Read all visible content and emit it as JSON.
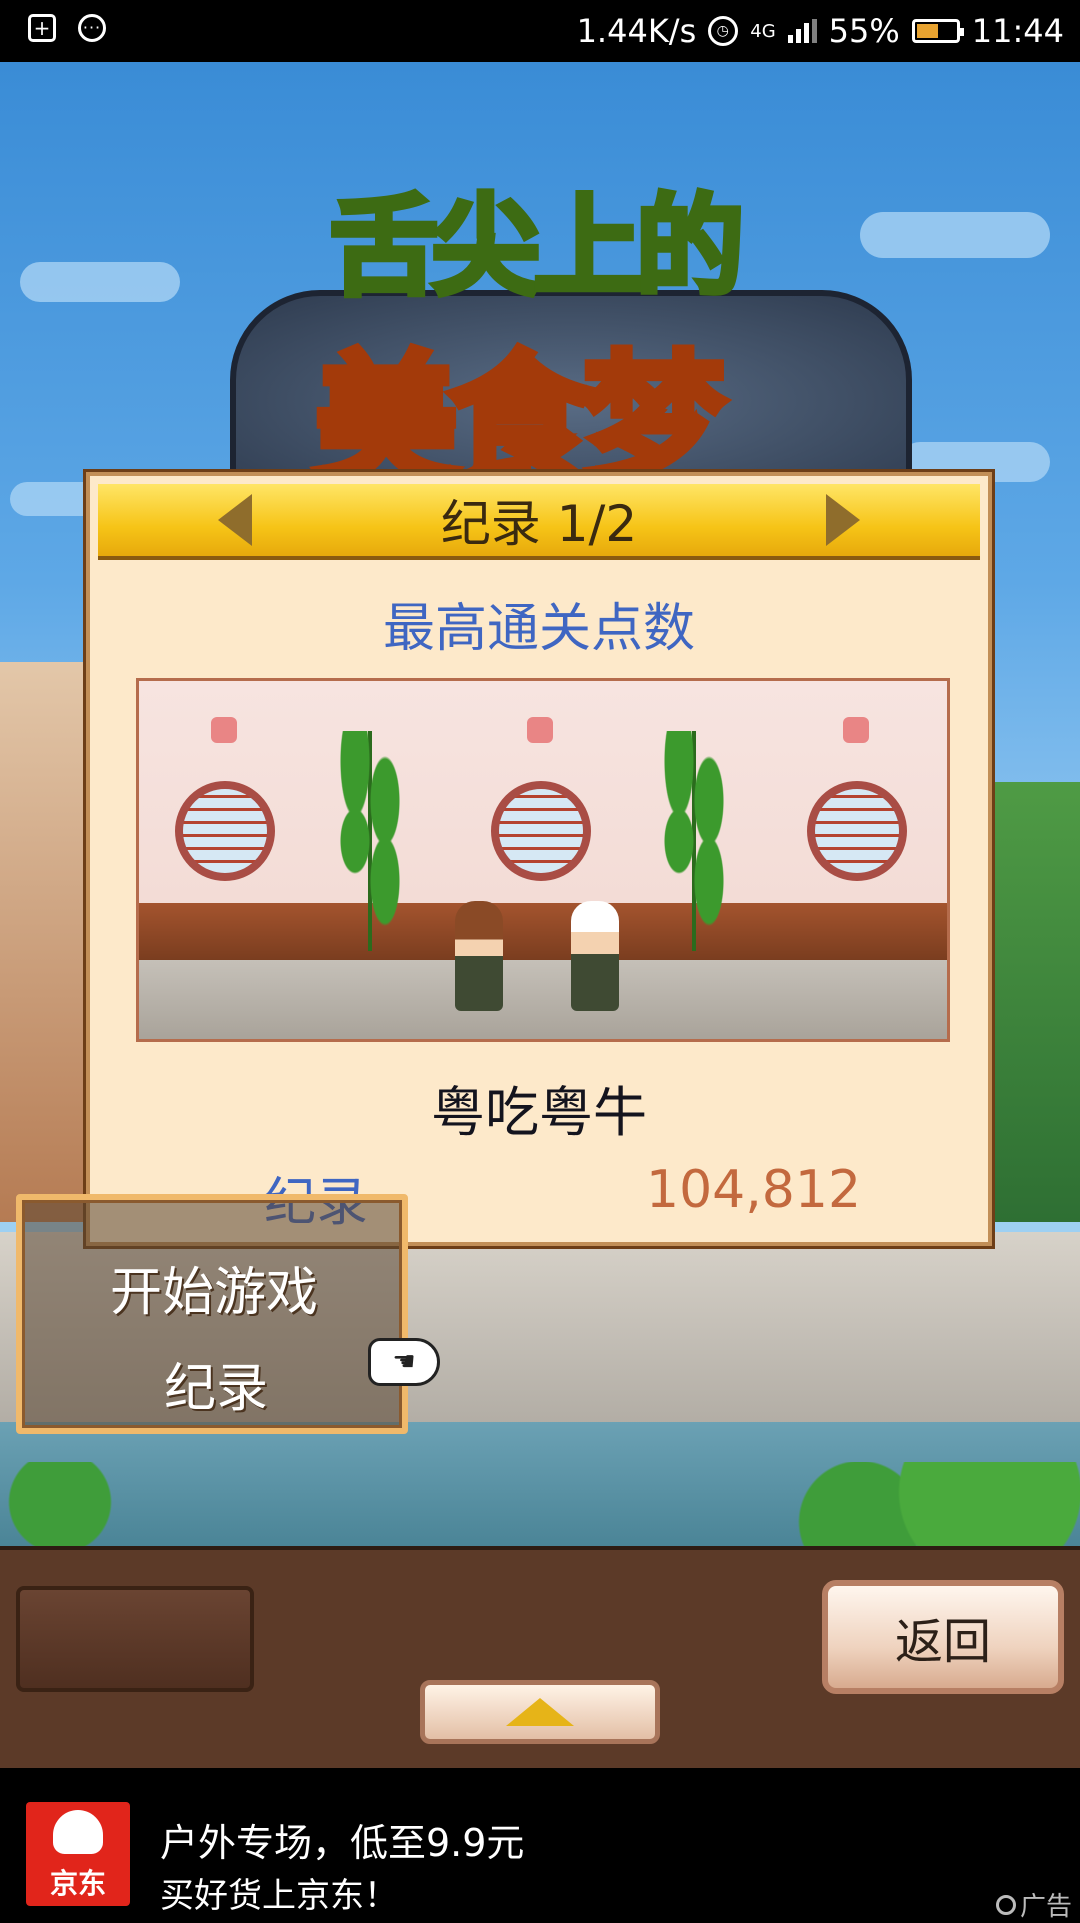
{
  "status_bar": {
    "network_speed": "1.44K/s",
    "network_type": "4G",
    "battery": "55%",
    "battery_level": 0.55,
    "time": "11:44",
    "icons": [
      "sim-add-icon",
      "more-dots-icon",
      "alarm-icon",
      "signal-icon",
      "battery-icon"
    ]
  },
  "game": {
    "logo_line1": "舌尖上的",
    "logo_line2": "美食梦"
  },
  "dialog": {
    "title": "纪录 1/2",
    "subtitle": "最高通关点数",
    "restaurant_name": "粤吃粤牛",
    "record_label": "纪录",
    "record_value": "104,812"
  },
  "menu": {
    "start": "开始游戏",
    "records": "纪录"
  },
  "bottom": {
    "back_label": "返回"
  },
  "ad": {
    "brand": "京东",
    "line1": "户外专场，低至9.9元",
    "line2": "买好货上京东！",
    "tag": "广告"
  },
  "colors": {
    "header_gold": "#f6c417",
    "dialog_bg": "#fde9ca",
    "subtitle_blue": "#3f66c2",
    "value_orange": "#c3693e",
    "ad_red": "#e1251b"
  }
}
